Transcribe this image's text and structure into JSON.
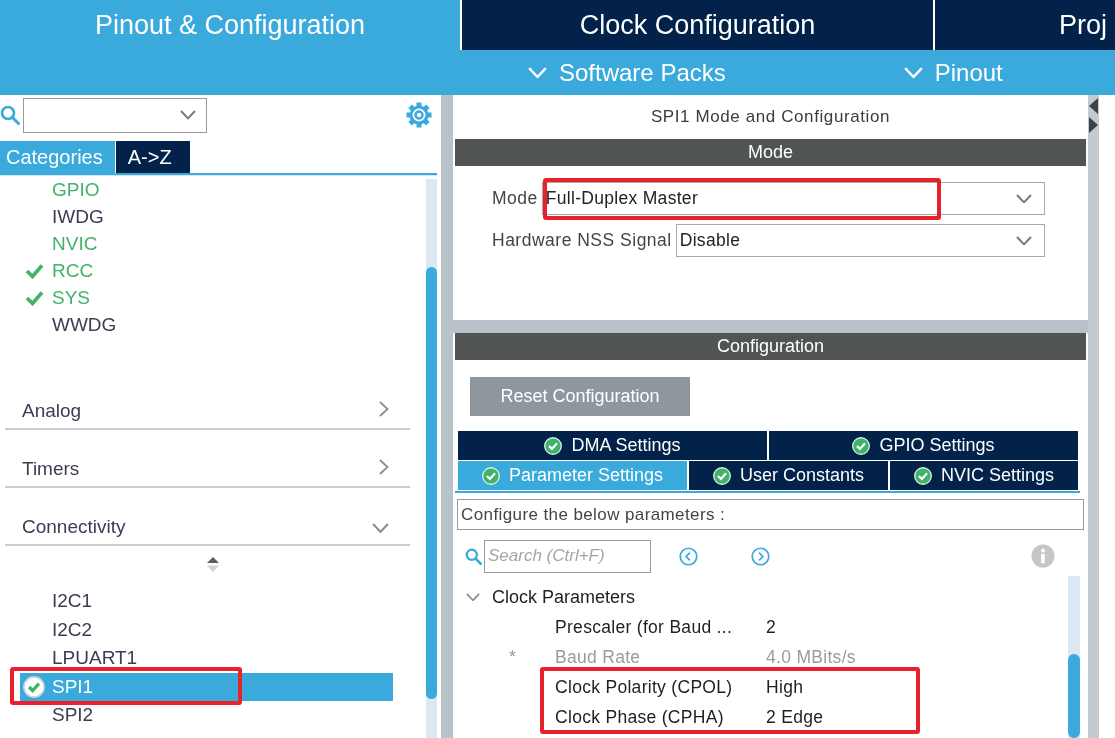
{
  "top_tabs": [
    {
      "label": "Pinout & Configuration",
      "selected": true
    },
    {
      "label": "Clock Configuration",
      "selected": false
    },
    {
      "label": "Proj",
      "selected": false
    }
  ],
  "sub_menu": [
    {
      "label": "Software Packs"
    },
    {
      "label": "Pinout"
    }
  ],
  "left_panel": {
    "view_tabs": [
      {
        "label": "Categories",
        "selected": true
      },
      {
        "label": "A->Z",
        "selected": false
      }
    ],
    "system_items": [
      {
        "label": "GPIO",
        "configured": true,
        "checked": false,
        "selected": false
      },
      {
        "label": "IWDG",
        "configured": false,
        "checked": false,
        "selected": false
      },
      {
        "label": "NVIC",
        "configured": true,
        "checked": false,
        "selected": false
      },
      {
        "label": "RCC",
        "configured": true,
        "checked": true,
        "selected": false
      },
      {
        "label": "SYS",
        "configured": true,
        "checked": true,
        "selected": false
      },
      {
        "label": "WWDG",
        "configured": false,
        "checked": false,
        "selected": false
      }
    ],
    "categories": [
      {
        "label": "Analog",
        "expanded": false
      },
      {
        "label": "Timers",
        "expanded": false
      },
      {
        "label": "Connectivity",
        "expanded": true,
        "items": [
          {
            "label": "I2C1",
            "configured": false,
            "checked": false,
            "selected": false,
            "highlighted": false
          },
          {
            "label": "I2C2",
            "configured": false,
            "checked": false,
            "selected": false,
            "highlighted": false
          },
          {
            "label": "LPUART1",
            "configured": false,
            "checked": false,
            "selected": false,
            "highlighted": false
          },
          {
            "label": "SPI1",
            "configured": true,
            "checked": true,
            "selected": true,
            "highlighted": true
          },
          {
            "label": "SPI2",
            "configured": false,
            "checked": false,
            "selected": false,
            "highlighted": false
          }
        ]
      }
    ]
  },
  "right_panel": {
    "title": "SPI1 Mode and Configuration",
    "mode_section": {
      "header": "Mode",
      "fields": [
        {
          "label": "Mode",
          "value": "Full-Duplex Master",
          "highlighted": true
        },
        {
          "label": "Hardware NSS Signal",
          "value": "Disable",
          "highlighted": false
        }
      ]
    },
    "config_section": {
      "header": "Configuration",
      "reset_button": "Reset Configuration",
      "tab_rows": [
        {
          "tabs": [
            {
              "label": "DMA Settings",
              "selected": false
            },
            {
              "label": "GPIO Settings",
              "selected": false
            }
          ]
        },
        {
          "tabs": [
            {
              "label": "Parameter Settings",
              "selected": true
            },
            {
              "label": "User Constants",
              "selected": false
            },
            {
              "label": "NVIC Settings",
              "selected": false
            }
          ]
        }
      ],
      "hint": "Configure the below parameters :",
      "search": {
        "placeholder": "Search (Ctrl+F)"
      },
      "groups": [
        {
          "label": "Clock Parameters",
          "expanded": true,
          "rows": [
            {
              "name": "Prescaler (for Baud ...",
              "value": "2",
              "kind": "editable",
              "highlighted": false
            },
            {
              "marker": "*",
              "name": "Baud Rate",
              "value": "4.0 MBits/s",
              "kind": "derived",
              "highlighted": false
            },
            {
              "name": "Clock Polarity (CPOL)",
              "value": "High",
              "kind": "editable",
              "highlighted": true
            },
            {
              "name": "Clock Phase (CPHA)",
              "value": "2 Edge",
              "kind": "editable",
              "highlighted": true
            }
          ]
        }
      ]
    }
  }
}
